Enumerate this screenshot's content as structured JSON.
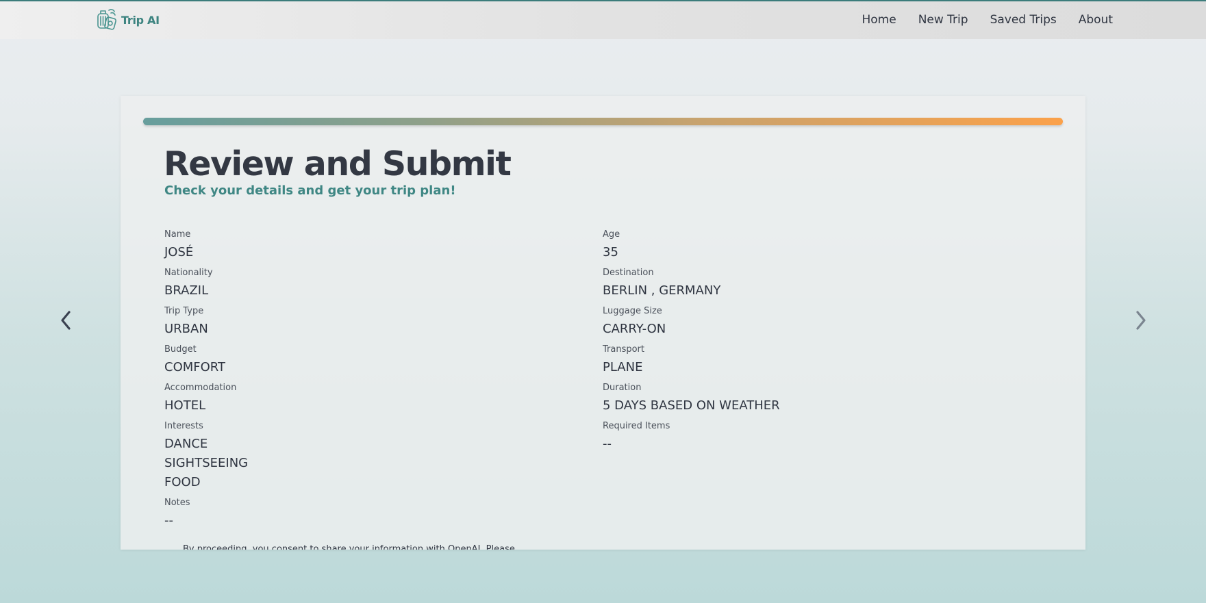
{
  "nav": {
    "brand": "Trip AI",
    "links": [
      "Home",
      "New Trip",
      "Saved Trips",
      "About"
    ]
  },
  "review": {
    "title": "Review and Submit",
    "subtitle": "Check your details and get your trip plan!",
    "progress_percent": 100,
    "fields": {
      "name": {
        "label": "Name",
        "value": "JOSÉ"
      },
      "age": {
        "label": "Age",
        "value": "35"
      },
      "nationality": {
        "label": "Nationality",
        "value": "BRAZIL"
      },
      "destination": {
        "label": "Destination",
        "value": "BERLIN , GERMANY"
      },
      "trip_type": {
        "label": "Trip Type",
        "value": "URBAN"
      },
      "luggage_size": {
        "label": "Luggage Size",
        "value": "CARRY-ON"
      },
      "budget": {
        "label": "Budget",
        "value": "COMFORT"
      },
      "transport": {
        "label": "Transport",
        "value": "PLANE"
      },
      "accommodation": {
        "label": "Accommodation",
        "value": "HOTEL"
      },
      "duration": {
        "label": "Duration",
        "value": "5 DAYS BASED ON WEATHER"
      },
      "interests": {
        "label": "Interests",
        "values": [
          "DANCE",
          "SIGHTSEEING",
          "FOOD"
        ]
      },
      "required_items": {
        "label": "Required Items",
        "value": "--"
      },
      "notes": {
        "label": "Notes",
        "value": "--"
      }
    },
    "consent": "By proceeding, you consent to share your information with OpenAI. Please"
  },
  "colors": {
    "accent": "#3d8480",
    "progress_start": "#679e9d",
    "progress_end": "#fba14a",
    "text": "#2f3541"
  },
  "icons": {
    "brand": "trip-ai-logo-icon",
    "prev": "chevron-left-icon",
    "next": "chevron-right-icon"
  }
}
